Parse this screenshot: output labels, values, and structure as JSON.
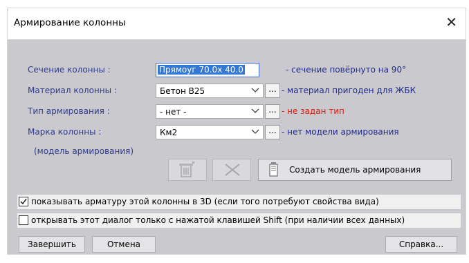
{
  "window": {
    "title": "Армирование колонны",
    "close_glyph": "✕"
  },
  "labels": {
    "section": "Сечение колонны :",
    "material": "Материал колонны :",
    "reinforcement_type": "Тип армирования :",
    "column_mark": "Марка колонны :",
    "model_hint": "(модель армирования)"
  },
  "fields": {
    "section_value": "Прямоуг  70.0x 40.0",
    "material_value": "Бетон В25",
    "reinforcement_type_value": "- нет -",
    "column_mark_value": "Км2",
    "ellipsis": "..."
  },
  "notes": {
    "section": "- сечение повёрнуто на 90°",
    "material": "- материал пригоден для ЖБК",
    "reinforcement_type": "- не задан тип",
    "column_mark": "- нет модели армирования"
  },
  "toolbar": {
    "create_model_label": "Создать модель армирования"
  },
  "checkboxes": {
    "show_3d": {
      "label": "показывать арматуру этой колонны в 3D (если того потребуют свойства вида)",
      "checked": true
    },
    "open_shift": {
      "label": "открывать этот диалог только с нажатой клавишей Shift (при наличии всех данных)",
      "checked": false
    }
  },
  "buttons": {
    "finish": "Завершить",
    "cancel": "Отмена",
    "help": "Справка..."
  },
  "colors": {
    "client_bg": "#c9c9ce",
    "label_blue": "#2f3b8c",
    "warning_red": "#e0180c",
    "selection_blue": "#3478d6"
  },
  "icons": [
    "close-icon",
    "chevron-down-icon",
    "delete-model-icon",
    "clear-x-icon",
    "document-icon",
    "checkmark-icon"
  ]
}
